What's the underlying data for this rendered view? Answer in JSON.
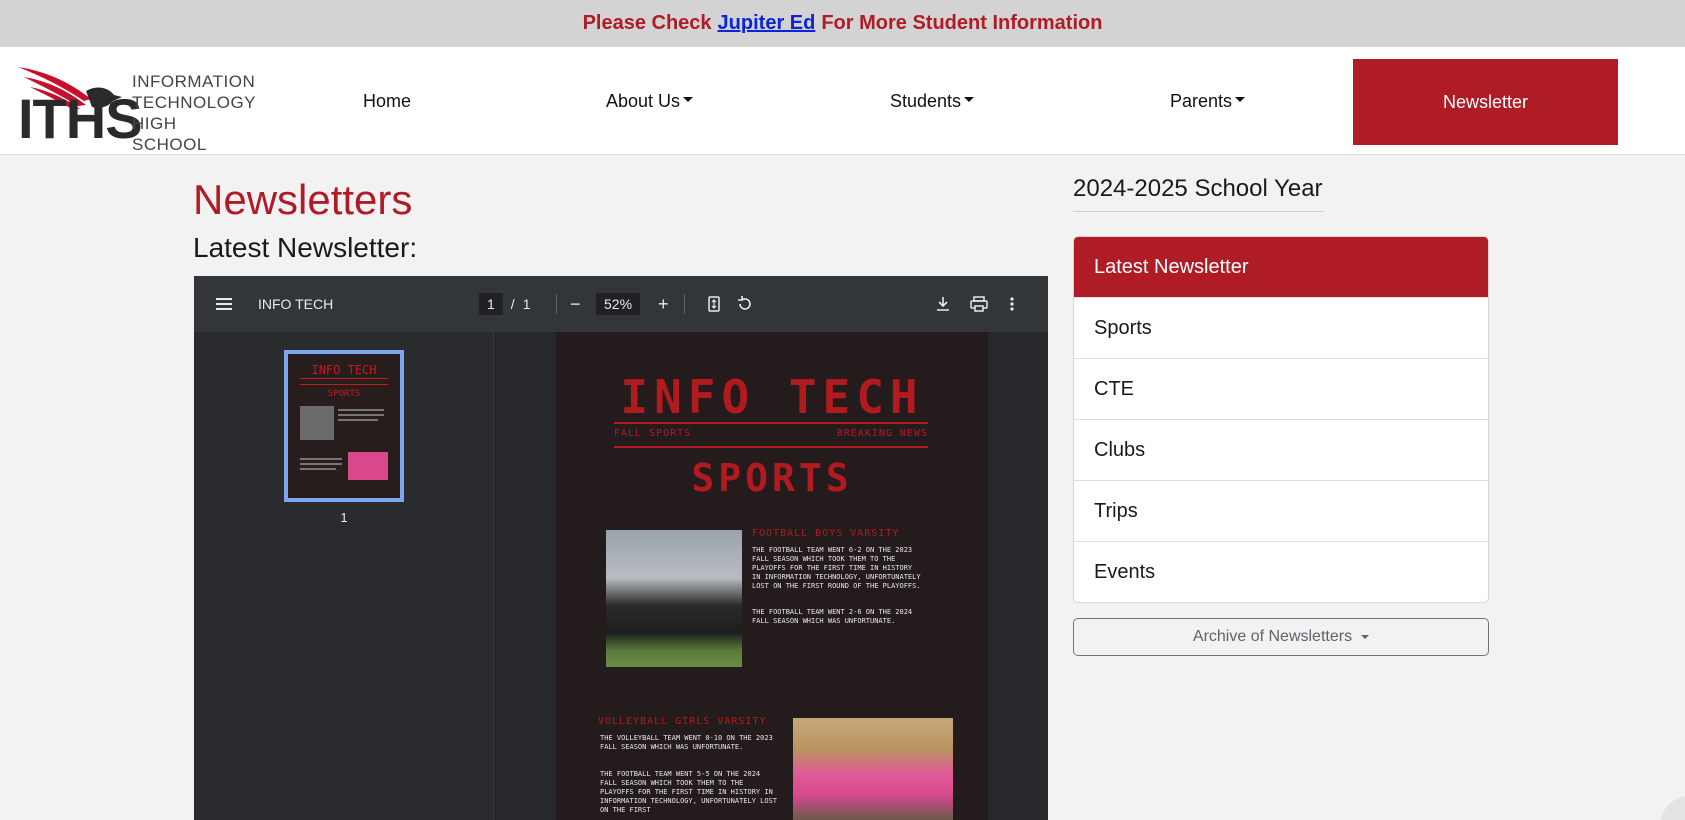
{
  "banner": {
    "prefix": "Please Check",
    "link": "Jupiter Ed",
    "suffix": "For More Student Information"
  },
  "logo": {
    "letters": "ITHS",
    "line1": "INFORMATION",
    "line2": "TECHNOLOGY",
    "line3": "HIGH SCHOOL"
  },
  "nav": {
    "home": "Home",
    "about": "About Us",
    "students": "Students",
    "parents": "Parents",
    "newsletter": "Newsletter"
  },
  "main": {
    "title": "Newsletters",
    "subtitle": "Latest Newsletter:"
  },
  "viewer": {
    "doc_title": "INFO TECH",
    "page_current": "1",
    "page_sep": "/",
    "page_total": "1",
    "zoom": "52%",
    "thumb_label": "1"
  },
  "pdf_page": {
    "title": "INFO TECH",
    "left_tag": "FALL SPORTS",
    "right_tag": "BREAKING NEWS",
    "section": "SPORTS",
    "football_head": "FOOTBALL BOYS VARSITY",
    "football_p1": "THE FOOTBALL TEAM WENT 6-2 ON THE 2023 FALL SEASON WHICH TOOK THEM TO THE PLAYOFFS FOR THE FIRST TIME IN HISTORY IN INFORMATION TECHNOLOGY, UNFORTUNATELY LOST ON THE FIRST ROUND OF THE PLAYOFFS.",
    "football_p2": "THE FOOTBALL TEAM WENT 2-6 ON THE 2024 FALL SEASON WHICH WAS UNFORTUNATE.",
    "volley_head": "VOLLEYBALL GIRLS VARSITY",
    "volley_p1": "THE VOLLEYBALL TEAM WENT 0-10 ON THE 2023 FALL SEASON WHICH WAS UNFORTUNATE.",
    "volley_p2": "THE FOOTBALL TEAM WENT 5-5 ON THE 2024 FALL SEASON WHICH TOOK THEM TO THE PLAYOFFS FOR THE FIRST TIME IN HISTORY IN INFORMATION TECHNOLOGY, UNFORTUNATELY LOST ON THE FIRST"
  },
  "sidebar": {
    "year": "2024-2025 School Year",
    "items": [
      {
        "label": "Latest Newsletter"
      },
      {
        "label": "Sports"
      },
      {
        "label": "CTE"
      },
      {
        "label": "Clubs"
      },
      {
        "label": "Trips"
      },
      {
        "label": "Events"
      }
    ],
    "archive": "Archive of Newsletters"
  },
  "colors": {
    "brand_red": "#b01c26",
    "link_blue": "#0a24d6",
    "viewer_bg": "#2a2a2e"
  }
}
